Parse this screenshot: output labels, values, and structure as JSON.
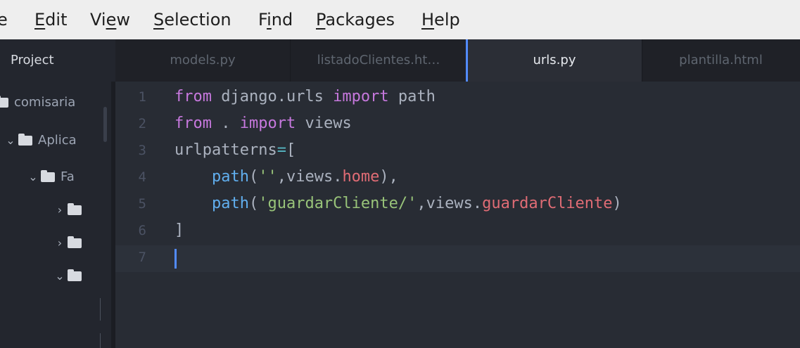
{
  "menu": [
    {
      "pre": "",
      "u": "",
      "post": "e"
    },
    {
      "pre": "",
      "u": "E",
      "post": "dit"
    },
    {
      "pre": "Vi",
      "u": "e",
      "post": "w"
    },
    {
      "pre": "",
      "u": "S",
      "post": "election"
    },
    {
      "pre": "F",
      "u": "i",
      "post": "nd"
    },
    {
      "pre": "",
      "u": "P",
      "post": "ackages"
    },
    {
      "pre": "",
      "u": "H",
      "post": "elp"
    }
  ],
  "tree_panel": {
    "title": "Project",
    "items": [
      {
        "label": "comisaria",
        "expanded": null
      },
      {
        "label": "Aplica",
        "expanded": true
      },
      {
        "label": "Fa",
        "expanded": true
      },
      {
        "label": "",
        "expanded": false
      },
      {
        "label": "",
        "expanded": false
      },
      {
        "label": "",
        "expanded": true
      }
    ]
  },
  "tabs": [
    {
      "label": "models.py",
      "active": false
    },
    {
      "label": "listadoClientes.ht…",
      "active": false
    },
    {
      "label": "urls.py",
      "active": true
    },
    {
      "label": "plantilla.html",
      "active": false
    }
  ],
  "editor": {
    "line_numbers": [
      "1",
      "2",
      "3",
      "4",
      "5",
      "6",
      "7"
    ],
    "active_line": 7,
    "lines": [
      [
        {
          "t": "kw",
          "v": "from"
        },
        {
          "t": "plain",
          "v": " django.urls "
        },
        {
          "t": "kw",
          "v": "import"
        },
        {
          "t": "plain",
          "v": " path"
        }
      ],
      [
        {
          "t": "kw",
          "v": "from"
        },
        {
          "t": "plain",
          "v": " . "
        },
        {
          "t": "kw",
          "v": "import"
        },
        {
          "t": "plain",
          "v": " views"
        }
      ],
      [
        {
          "t": "plain",
          "v": "urlpatterns"
        },
        {
          "t": "op",
          "v": "="
        },
        {
          "t": "plain",
          "v": "["
        }
      ],
      [
        {
          "t": "plain",
          "v": "    "
        },
        {
          "t": "fn",
          "v": "path"
        },
        {
          "t": "plain",
          "v": "("
        },
        {
          "t": "str",
          "v": "''"
        },
        {
          "t": "plain",
          "v": ",views."
        },
        {
          "t": "attr",
          "v": "home"
        },
        {
          "t": "plain",
          "v": "),"
        }
      ],
      [
        {
          "t": "plain",
          "v": "    "
        },
        {
          "t": "fn",
          "v": "path"
        },
        {
          "t": "plain",
          "v": "("
        },
        {
          "t": "str",
          "v": "'guardarCliente/'"
        },
        {
          "t": "plain",
          "v": ",views."
        },
        {
          "t": "attr",
          "v": "guardarCliente"
        },
        {
          "t": "plain",
          "v": ")"
        }
      ],
      [
        {
          "t": "plain",
          "v": "]"
        }
      ],
      []
    ]
  },
  "colors": {
    "keyword": "#c678dd",
    "function": "#61afef",
    "string": "#98c379",
    "attribute": "#e06c75",
    "cursor": "#528bff"
  }
}
